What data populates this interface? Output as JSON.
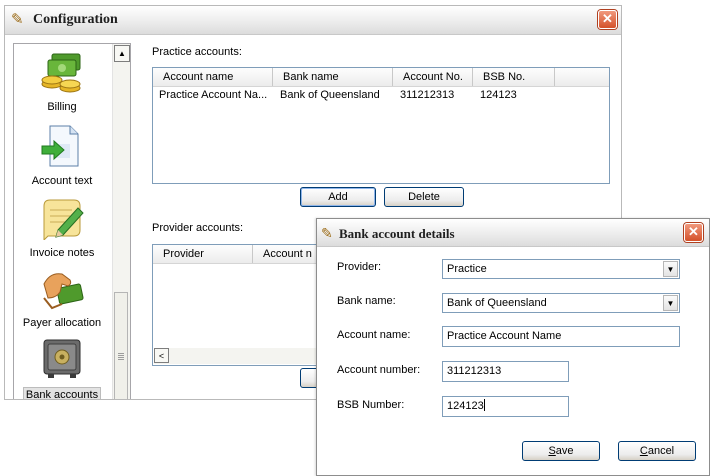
{
  "window": {
    "title": "Configuration",
    "close_glyph": "✕"
  },
  "sidebar": {
    "items": [
      {
        "label": "Billing",
        "icon": "billing-coins-icon"
      },
      {
        "label": "Account text",
        "icon": "account-text-document-icon"
      },
      {
        "label": "Invoice notes",
        "icon": "invoice-notes-pencil-icon"
      },
      {
        "label": "Payer allocation",
        "icon": "payer-allocation-hand-icon"
      },
      {
        "label": "Bank accounts",
        "icon": "bank-accounts-safe-icon"
      }
    ],
    "scroll_up_glyph": "▲"
  },
  "practice_accounts": {
    "label": "Practice accounts:",
    "columns": [
      "Account name",
      "Bank name",
      "Account No.",
      "BSB No."
    ],
    "rows": [
      [
        "Practice Account Na...",
        "Bank of Queensland",
        "311212313",
        "124123"
      ]
    ],
    "add_label": "Add",
    "delete_label": "Delete"
  },
  "provider_accounts": {
    "label": "Provider accounts:",
    "columns": [
      "Provider",
      "Account n"
    ],
    "scroll_left_glyph": "<"
  },
  "dialog": {
    "title": "Bank account details",
    "close_glyph": "✕",
    "provider_label": "Provider:",
    "provider_value": "Practice",
    "bank_name_label": "Bank name:",
    "bank_name_value": "Bank of Queensland",
    "account_name_label": "Account name:",
    "account_name_value": "Practice Account Name",
    "account_number_label": "Account number:",
    "account_number_value": "311212313",
    "bsb_label": "BSB Number:",
    "bsb_value": "124123",
    "save_accesskey": "S",
    "save_rest": "ave",
    "cancel_accesskey": "C",
    "cancel_rest": "ancel",
    "dropdown_glyph": "▼"
  },
  "colors": {
    "close_button": "#d4512a",
    "list_border": "#7f9db9",
    "button_border": "#003c74"
  }
}
